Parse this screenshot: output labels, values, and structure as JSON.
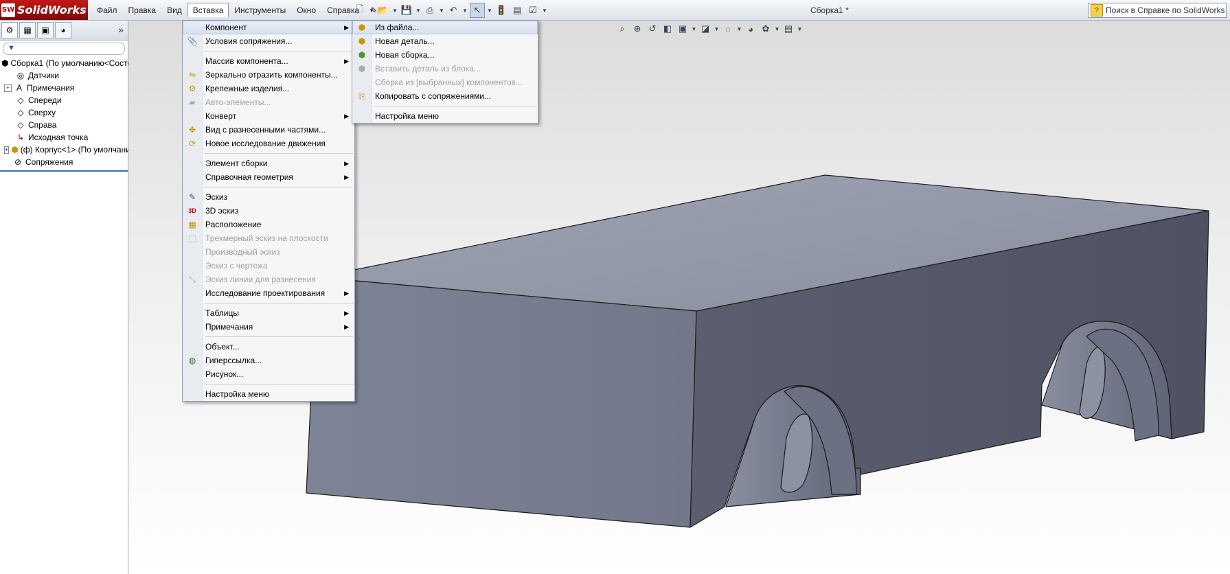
{
  "app": {
    "logo_mark": "SW",
    "logo_text": "SolidWorks",
    "document_title": "Сборка1 *"
  },
  "menubar": [
    "Файл",
    "Правка",
    "Вид",
    "Вставка",
    "Инструменты",
    "Окно",
    "Справка"
  ],
  "help_search": {
    "placeholder": "Поиск в Справке по SolidWorks"
  },
  "feature_tree": {
    "root": "Сборка1  (По умолчанию<Состо",
    "items": [
      {
        "label": "Датчики",
        "icon": "sensor-icon",
        "expandable": false
      },
      {
        "label": "Примечания",
        "icon": "annotation-icon",
        "expandable": true
      },
      {
        "label": "Спереди",
        "icon": "plane-icon",
        "expandable": false
      },
      {
        "label": "Сверху",
        "icon": "plane-icon",
        "expandable": false
      },
      {
        "label": "Справа",
        "icon": "plane-icon",
        "expandable": false
      },
      {
        "label": "Исходная точка",
        "icon": "origin-icon",
        "expandable": false
      },
      {
        "label": "(ф) Корпус<1> (По умолчани",
        "icon": "part-icon",
        "expandable": true
      },
      {
        "label": "Сопряжения",
        "icon": "mates-icon",
        "expandable": false
      }
    ]
  },
  "insert_menu": {
    "items": [
      {
        "label": "Компонент",
        "submenu": true,
        "highlight": true
      },
      {
        "label": "Условия сопряжения...",
        "icon": "paperclip-icon"
      },
      {
        "sep": true
      },
      {
        "label": "Массив компонента...",
        "submenu": true
      },
      {
        "label": "Зеркально отразить компоненты...",
        "icon": "mirror-icon"
      },
      {
        "label": "Крепежные изделия...",
        "icon": "fastener-icon"
      },
      {
        "label": "Авто-элементы...",
        "icon": "folder-icon",
        "disabled": true
      },
      {
        "label": "Конверт",
        "submenu": true
      },
      {
        "label": "Вид с разнесенными частями...",
        "icon": "explode-icon"
      },
      {
        "label": "Новое исследование движения",
        "icon": "motion-icon"
      },
      {
        "sep": true
      },
      {
        "label": "Элемент сборки",
        "submenu": true
      },
      {
        "label": "Справочная геометрия",
        "submenu": true
      },
      {
        "sep": true
      },
      {
        "label": "Эскиз",
        "icon": "sketch-icon"
      },
      {
        "label": "3D эскиз",
        "icon": "sketch3d-icon"
      },
      {
        "label": "Расположение",
        "icon": "layout-icon"
      },
      {
        "label": "Трехмерный эскиз на плоскости",
        "icon": "sketch-plane-icon",
        "disabled": true
      },
      {
        "label": "Производный эскиз",
        "disabled": true
      },
      {
        "label": "Эскиз с чертежа",
        "disabled": true
      },
      {
        "label": "Эскиз линии для разнесения",
        "icon": "explode-line-icon",
        "disabled": true
      },
      {
        "label": "Исследование проектирования",
        "submenu": true
      },
      {
        "sep": true
      },
      {
        "label": "Таблицы",
        "submenu": true
      },
      {
        "label": "Примечания",
        "submenu": true
      },
      {
        "sep": true
      },
      {
        "label": "Объект..."
      },
      {
        "label": "Гиперссылка...",
        "icon": "globe-icon"
      },
      {
        "label": "Рисунок..."
      },
      {
        "sep": true
      },
      {
        "label": "Настройка меню"
      }
    ]
  },
  "component_submenu": {
    "items": [
      {
        "label": "Из файла...",
        "icon": "from-file-icon",
        "highlight": true
      },
      {
        "label": "Новая деталь...",
        "icon": "new-part-icon"
      },
      {
        "label": "Новая сборка...",
        "icon": "new-assembly-icon"
      },
      {
        "label": "Вставить деталь из блока...",
        "icon": "part-from-block-icon",
        "disabled": true
      },
      {
        "label": "Сборка из [выбранных] компонентов...",
        "disabled": true
      },
      {
        "label": "Копировать с сопряжениями...",
        "icon": "copy-mates-icon"
      },
      {
        "sep": true
      },
      {
        "label": "Настройка меню"
      }
    ]
  },
  "colors": {
    "face_top": "#9398a8",
    "face_front": "#7a8092",
    "face_side": "#555968",
    "hole": "#6d7283",
    "edge": "#1b1b1b"
  }
}
